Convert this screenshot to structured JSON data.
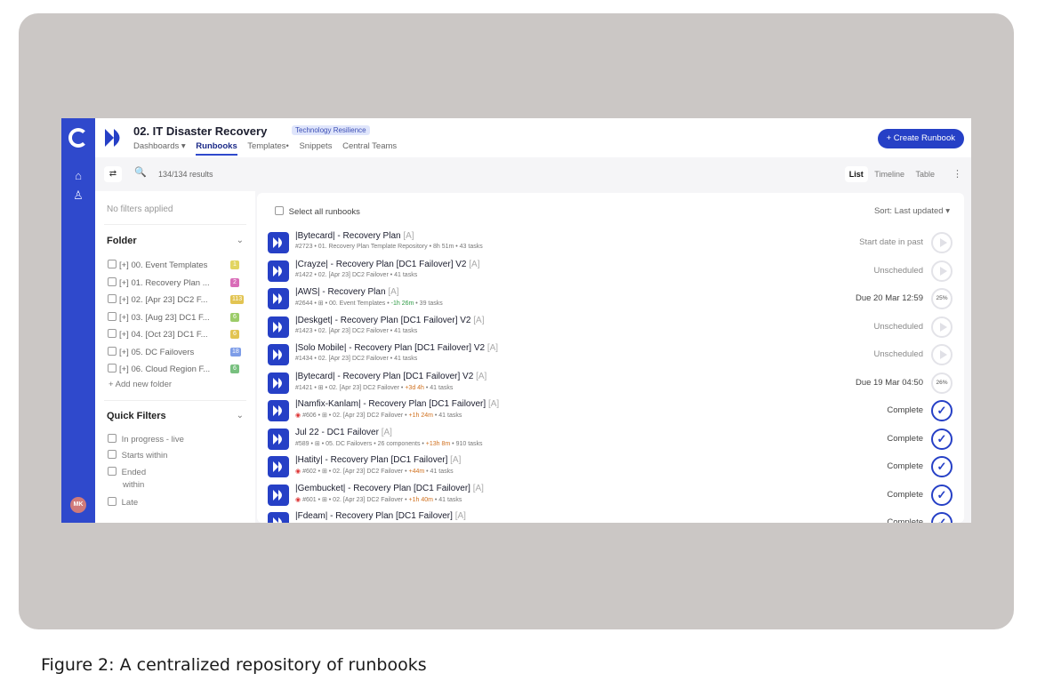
{
  "header": {
    "title": "02. IT Disaster Recovery",
    "tag": "Technology Resilience",
    "nav": [
      {
        "label": "Dashboards ▾"
      },
      {
        "label": "Runbooks"
      },
      {
        "label": "Templates•"
      },
      {
        "label": "Snippets"
      },
      {
        "label": "Central Teams"
      }
    ],
    "create_label": "+ Create Runbook"
  },
  "rail": {
    "avatar": "MK",
    "icons": [
      "home-icon",
      "team-icon"
    ]
  },
  "toolbar": {
    "results": "134/134 results",
    "views": [
      "List",
      "Timeline",
      "Table"
    ],
    "kebab": "⋮"
  },
  "sidebar": {
    "no_filters": "No filters applied",
    "folder_title": "Folder",
    "folders": [
      {
        "label": "00. Event Templates",
        "count": "1",
        "color": "#e2d562"
      },
      {
        "label": "01. Recovery Plan ...",
        "count": "2",
        "color": "#d96db8"
      },
      {
        "label": "02. [Apr 23] DC2 F...",
        "count": "113",
        "color": "#e2c452"
      },
      {
        "label": "03. [Aug 23] DC1 F...",
        "count": "6",
        "color": "#9ccc69"
      },
      {
        "label": "04. [Oct 23] DC1 F...",
        "count": "6",
        "color": "#e2c452"
      },
      {
        "label": "05. DC Failovers",
        "count": "18",
        "color": "#7e9de8"
      },
      {
        "label": "06. Cloud Region F...",
        "count": "6",
        "color": "#78c07f"
      }
    ],
    "add_folder": "+ Add new folder",
    "quick_filters_title": "Quick Filters",
    "quick_filters": [
      "In progress - live",
      "Starts within",
      "Ended",
      "within",
      "Late"
    ]
  },
  "main": {
    "select_all": "Select all runbooks",
    "sort": "Sort: Last updated ▾",
    "rows": [
      {
        "name": "|Bytecard| - Recovery Plan",
        "marker": "[A]",
        "meta_a": "#2723 • 01. Recovery Plan Template Repository • 8h 51m • 43 tasks",
        "meta_hl": "",
        "meta_b": "",
        "hl": "",
        "dot": "",
        "status": "Start date in past",
        "state": "play",
        "progress": "",
        "muted": true
      },
      {
        "name": "|Crayze| - Recovery Plan [DC1 Failover] V2",
        "marker": "[A]",
        "meta_a": "#1422 • 02. [Apr 23] DC2 Failover • 41 tasks",
        "meta_hl": "",
        "meta_b": "",
        "hl": "",
        "dot": "",
        "status": "Unscheduled",
        "state": "play",
        "progress": "",
        "muted": true
      },
      {
        "name": "|AWS| - Recovery Plan",
        "marker": "[A]",
        "meta_a": "#2644 • ⊞ • 00. Event Templates • ",
        "meta_hl": "-1h 26m",
        "meta_b": " • 39 tasks",
        "hl": "g",
        "dot": "",
        "status": "Due 20 Mar 12:59",
        "state": "progress",
        "progress": "25%",
        "muted": false
      },
      {
        "name": "|Deskget| - Recovery Plan [DC1 Failover] V2",
        "marker": "[A]",
        "meta_a": "#1423 • 02. [Apr 23] DC2 Failover • 41 tasks",
        "meta_hl": "",
        "meta_b": "",
        "hl": "",
        "dot": "",
        "status": "Unscheduled",
        "state": "play",
        "progress": "",
        "muted": true
      },
      {
        "name": "|Solo Mobile| - Recovery Plan [DC1 Failover] V2",
        "marker": "[A]",
        "meta_a": "#1434 • 02. [Apr 23] DC2 Failover • 41 tasks",
        "meta_hl": "",
        "meta_b": "",
        "hl": "",
        "dot": "",
        "status": "Unscheduled",
        "state": "play",
        "progress": "",
        "muted": true
      },
      {
        "name": "|Bytecard| - Recovery Plan [DC1 Failover] V2",
        "marker": "[A]",
        "meta_a": "#1421 • ⊞ • 02. [Apr 23] DC2 Failover • ",
        "meta_hl": "+3d 4h",
        "meta_b": " • 41 tasks",
        "hl": "o",
        "dot": "",
        "status": "Due 19 Mar 04:50",
        "state": "progress",
        "progress": "26%",
        "muted": false
      },
      {
        "name": "|Namfix-Kanlam| - Recovery Plan [DC1 Failover]",
        "marker": "[A]",
        "meta_a": "#606 • ⊞ • 02. [Apr 23] DC2 Failover • ",
        "meta_hl": "+1h 24m",
        "meta_b": " • 41 tasks",
        "hl": "o",
        "dot": "◉ ",
        "status": "Complete",
        "state": "done",
        "progress": "",
        "muted": false
      },
      {
        "name": "Jul 22 - DC1 Failover",
        "marker": "[A]",
        "meta_a": "#589 • ⊞ • 05. DC Failovers • 26 components • ",
        "meta_hl": "+13h 8m",
        "meta_b": " • 910 tasks",
        "hl": "o",
        "dot": "",
        "status": "Complete",
        "state": "done",
        "progress": "",
        "muted": false
      },
      {
        "name": "|Hatity| - Recovery Plan [DC1 Failover]",
        "marker": "[A]",
        "meta_a": "#602 • ⊞ • 02. [Apr 23] DC2 Failover • ",
        "meta_hl": "+44m",
        "meta_b": " • 41 tasks",
        "hl": "o",
        "dot": "◉ ",
        "status": "Complete",
        "state": "done",
        "progress": "",
        "muted": false
      },
      {
        "name": "|Gembucket| - Recovery Plan [DC1 Failover]",
        "marker": "[A]",
        "meta_a": "#601 • ⊞ • 02. [Apr 23] DC2 Failover • ",
        "meta_hl": "+1h 40m",
        "meta_b": " • 41 tasks",
        "hl": "o",
        "dot": "◉ ",
        "status": "Complete",
        "state": "done",
        "progress": "",
        "muted": false
      },
      {
        "name": "|Fdeam| - Recovery Plan [DC1 Failover]",
        "marker": "[A]",
        "meta_a": "",
        "meta_hl": "",
        "meta_b": "",
        "hl": "",
        "dot": "",
        "status": "Complete",
        "state": "done",
        "progress": "",
        "muted": false
      }
    ]
  },
  "caption": "Figure 2: A centralized repository of runbooks"
}
